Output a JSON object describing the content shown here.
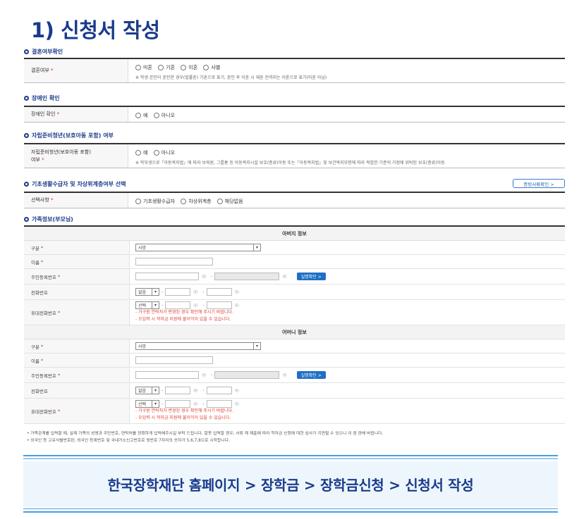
{
  "title": "1) 신청서 작성",
  "marriage": {
    "heading": "결혼여부확인",
    "label": "결혼여부",
    "options": [
      "미혼",
      "기혼",
      "이혼",
      "사별"
    ],
    "note": "※ 학생 본인이 혼인한 경우(법률혼) 기혼으로 표기, 혼인 후 이혼 시 재혼 전까지는 이혼으로 표기(미혼 아님)"
  },
  "disability": {
    "heading": "장애인 확인",
    "label": "장애인 확인",
    "options": [
      "예",
      "아니오"
    ]
  },
  "selfreliance": {
    "heading": "자립준비청년(보호아동 포함) 여부",
    "label_line1": "자립준비청년(보호아동 포함)",
    "label_line2": "여부",
    "options": [
      "예",
      "아니오"
    ],
    "note": "※ 학부생으로「아동복지법」에 따라 보육원, 그룹홈 등 아동복지시설 보호(종료)아동 또는「아동복지법」및 보건복지부령에 따라 적합한 기준의 가정에 위탁된 보호(종료)아동"
  },
  "welfare": {
    "heading": "기초생활수급자 및 차상위계층여부 선택",
    "doc_button": "증빙서류확인 >",
    "label": "선택사항",
    "options": [
      "기초생활수급자",
      "차상위계층",
      "해당없음"
    ]
  },
  "family": {
    "heading": "가족정보(부모님)",
    "father_head": "아버지 정보",
    "mother_head": "어머니 정보",
    "labels": {
      "type": "구분",
      "name": "이름",
      "rrn": "주민등록번호",
      "phone": "전화번호",
      "mobile": "휴대전화번호"
    },
    "type_value": "사망",
    "phone_select": "없음",
    "mobile_select": "선택",
    "verify_button": "실명확인 >",
    "red_note1": "- 가구원 연락처가 변경된 경우 확인해 주시기 바랍니다.",
    "red_note2": "- 오입력 시 학자금 지원에 불이익이 있을 수 있습니다."
  },
  "footnotes": [
    "• 가족관계를 입력할 때, 실제 가족의 성명과 주민번호, 연락처를 정확하게 입력해주시길 부탁 드립니다. 잘못 입력할 경우, 서류 재 제출에 따라 학자금 신청에 대한 심사가 지연될 수 있으니 이 점 양해 바랍니다.",
    "• 외국인 등 고유식별번호란, 외국인 등록번호 및 국내거소신고번호로 뒷번호 7자리의 숫자가 5,6,7,8으로 시작합니다."
  ],
  "banner": "한국장학재단 홈페이지 > 장학금 > 장학금신청 > 신청서 작성",
  "colors": {
    "title": "#1a3b8b",
    "accent": "#4a9fe0",
    "button": "#1f6fc4",
    "warning": "#e03b2e"
  }
}
